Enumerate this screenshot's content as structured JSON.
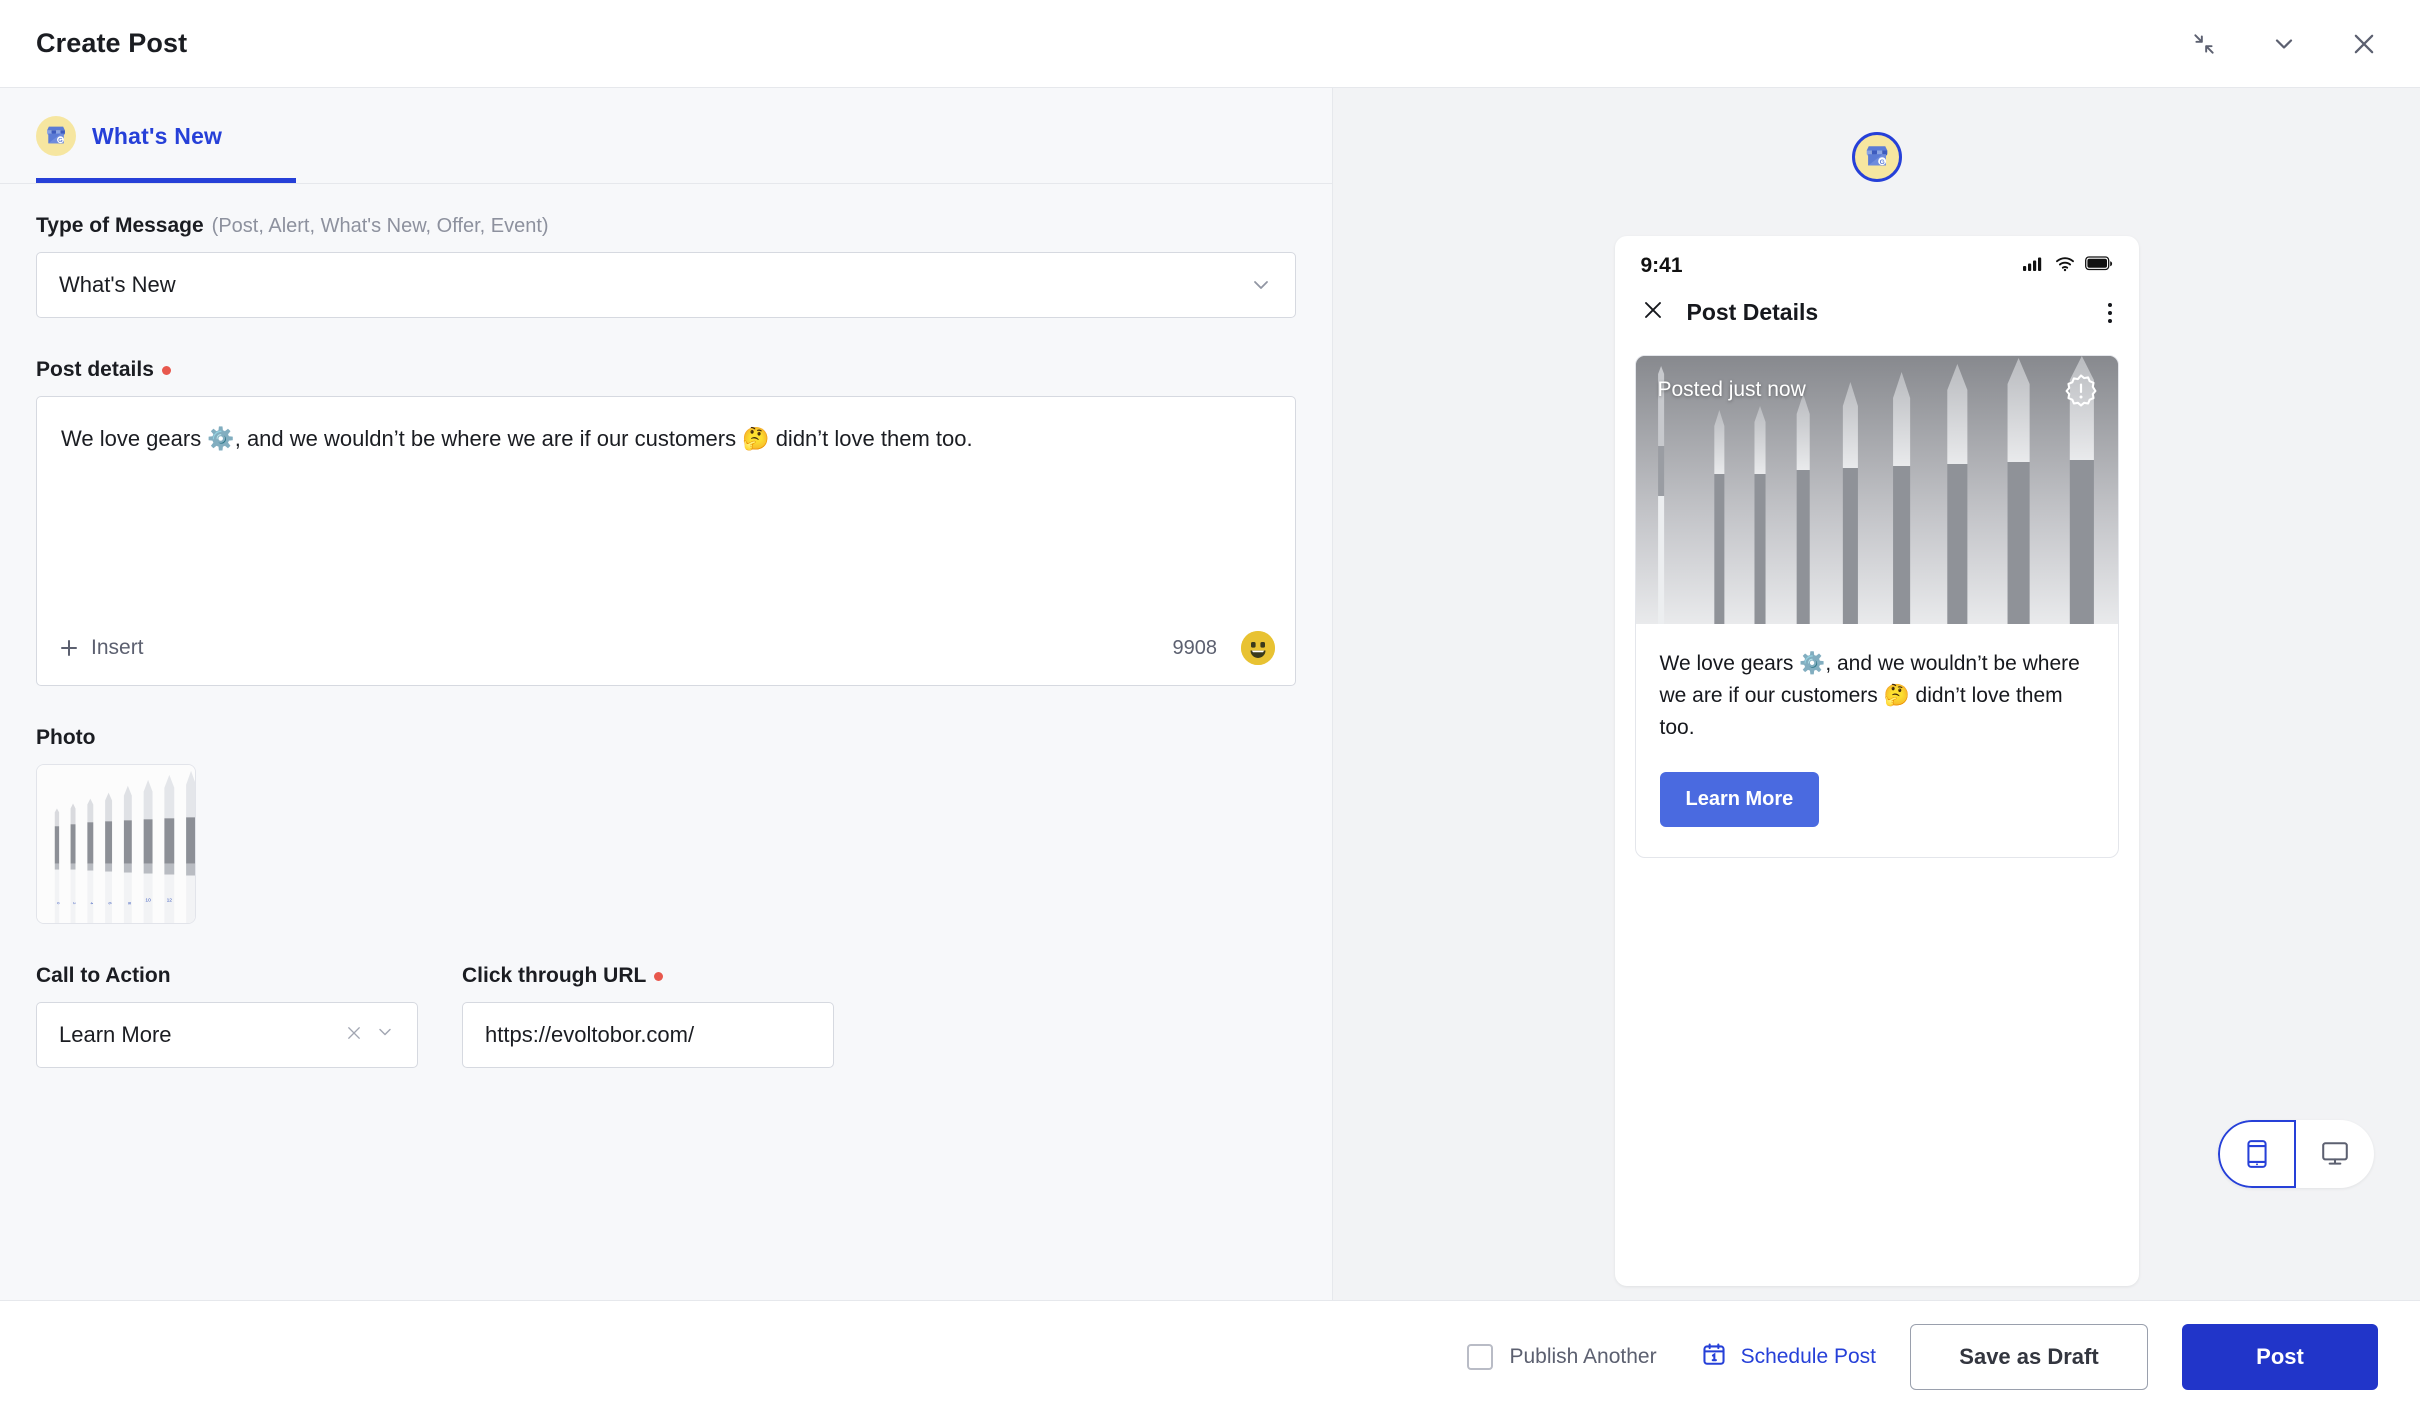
{
  "window": {
    "title": "Create Post",
    "controls": [
      {
        "name": "collapse",
        "glyph": "collapse-icon"
      },
      {
        "name": "minimize",
        "glyph": "chevron-down-icon"
      },
      {
        "name": "close",
        "glyph": "close-icon"
      }
    ]
  },
  "tabs": [
    {
      "label": "What's New",
      "icon": "google-business-profile-icon",
      "active": true
    }
  ],
  "form": {
    "type_of_message": {
      "label": "Type of Message",
      "hint": "(Post, Alert, What's New, Offer, Event)",
      "value": "What's New",
      "options": [
        "Post",
        "Alert",
        "What's New",
        "Offer",
        "Event"
      ]
    },
    "post_details": {
      "label": "Post details",
      "required": true,
      "value": "We love gears ⚙️, and we wouldn’t be where we are if our customers 🤔 didn’t love them too.",
      "insert_label": "Insert",
      "char_count": "9908",
      "emoji_icon": "smiley-icon"
    },
    "photo": {
      "label": "Photo",
      "alt": "set of white-handled round paint brushes sizes 0 to 16"
    },
    "call_to_action": {
      "label": "Call to Action",
      "value": "Learn More",
      "clear_icon": "close-icon",
      "chevron_icon": "chevron-down-icon"
    },
    "click_through_url": {
      "label": "Click through URL",
      "required": true,
      "value": "https://evoltobor.com/"
    }
  },
  "preview": {
    "profile_icon": "google-business-profile-icon",
    "phone": {
      "status_time": "9:41",
      "status_icons": [
        "cellular-signal-icon",
        "wifi-icon",
        "battery-icon"
      ],
      "nav": {
        "close_icon": "close-icon",
        "title": "Post Details",
        "menu_icon": "more-vertical-icon"
      },
      "post": {
        "posted_label": "Posted just now",
        "alert_icon": "alert-badge-icon",
        "text": "We love gears ⚙️, and we wouldn’t be where we are if our customers 🤔 didn’t love them too.",
        "cta_label": "Learn More"
      }
    },
    "device_toggle": [
      {
        "name": "mobile",
        "icon": "mobile-icon",
        "active": true
      },
      {
        "name": "desktop",
        "icon": "desktop-icon",
        "active": false
      }
    ]
  },
  "footer": {
    "publish_another": {
      "label": "Publish Another",
      "checked": false
    },
    "schedule_post": {
      "label": "Schedule Post",
      "icon": "calendar-icon"
    },
    "save_draft": "Save as Draft",
    "post": "Post"
  },
  "colors": {
    "accent_blue": "#2640d8",
    "post_button": "#2135c9",
    "preview_cta": "#4a6ae0",
    "required_dot": "#e8584d",
    "emoji_yellow": "#e8c232",
    "page_bg": "#f7f8fa",
    "preview_bg": "#f2f3f5"
  }
}
